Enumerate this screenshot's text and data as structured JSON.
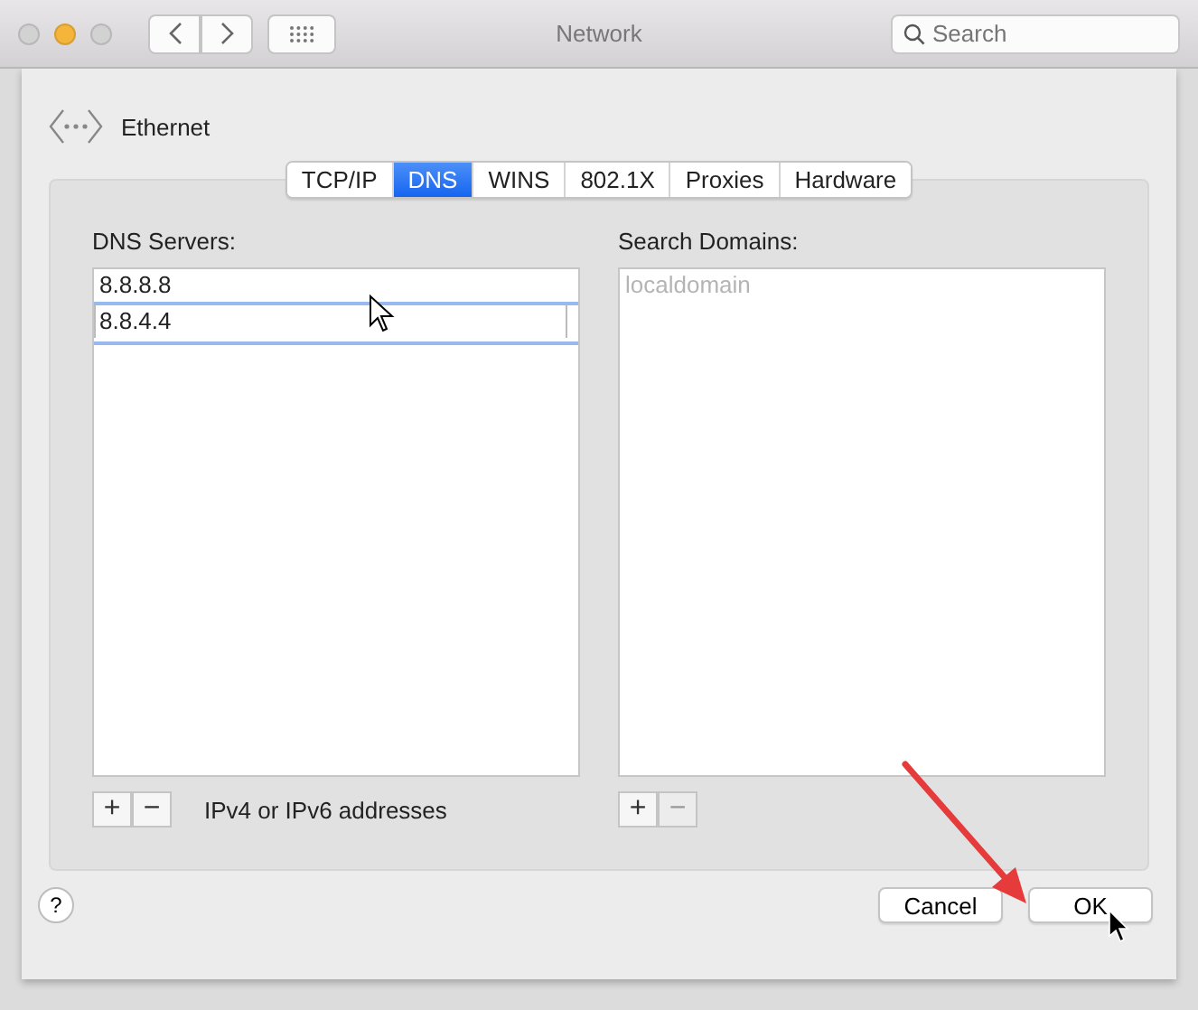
{
  "window": {
    "title": "Network",
    "traffic_lights": [
      {
        "color": "#d3d2d3"
      },
      {
        "color": "#f5b53b"
      },
      {
        "color": "#d3d2d3"
      }
    ]
  },
  "search": {
    "placeholder": "Search"
  },
  "interface": {
    "name": "Ethernet"
  },
  "tabs": [
    {
      "label": "TCP/IP",
      "selected": false
    },
    {
      "label": "DNS",
      "selected": true
    },
    {
      "label": "WINS",
      "selected": false
    },
    {
      "label": "802.1X",
      "selected": false
    },
    {
      "label": "Proxies",
      "selected": false
    },
    {
      "label": "Hardware",
      "selected": false
    }
  ],
  "dns_servers": {
    "label": "DNS Servers:",
    "entries": [
      {
        "value": "8.8.8.8",
        "editing": false
      },
      {
        "value": "8.8.4.4",
        "editing": true
      }
    ],
    "add": {
      "label": "+",
      "disabled": false
    },
    "remove": {
      "label": "−",
      "disabled": false
    },
    "hint": "IPv4 or IPv6 addresses"
  },
  "search_domains": {
    "label": "Search Domains:",
    "entries": [
      {
        "value": "localdomain",
        "dimmed": true
      }
    ],
    "add": {
      "label": "+",
      "disabled": false
    },
    "remove": {
      "label": "−",
      "disabled": true
    }
  },
  "help": {
    "label": "?"
  },
  "buttons": [
    {
      "label": "Cancel"
    },
    {
      "label": "OK"
    }
  ]
}
